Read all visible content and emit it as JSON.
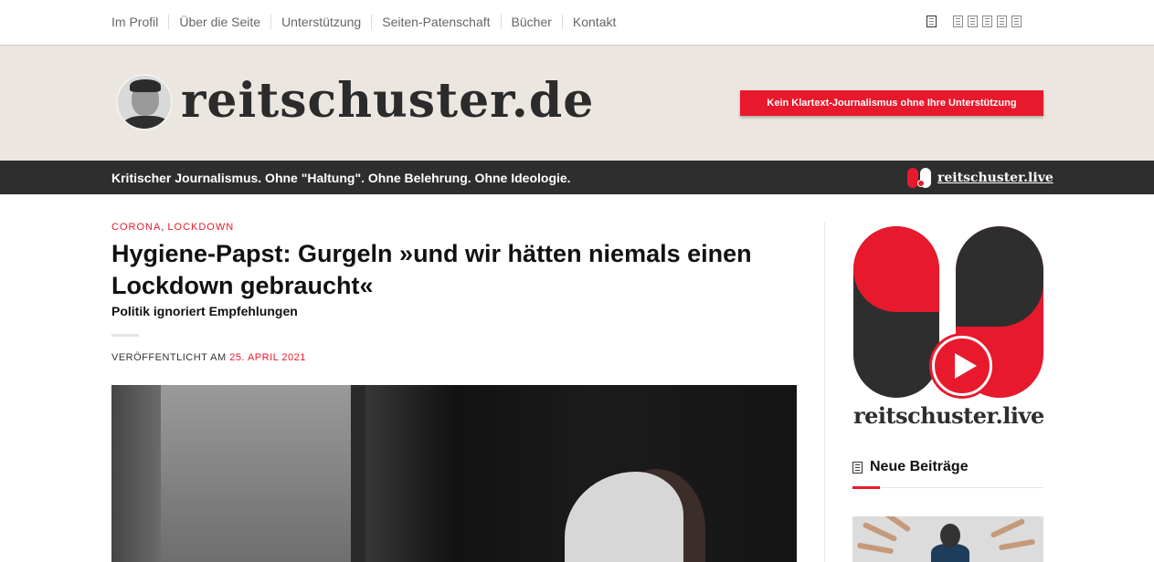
{
  "nav": {
    "links": [
      "Im Profil",
      "Über die Seite",
      "Unterstützung",
      "Seiten-Patenschaft",
      "Bücher",
      "Kontakt"
    ]
  },
  "header": {
    "logo_text": "reitschuster.de",
    "support_button": "Kein Klartext-Journalismus ohne Ihre Unterstützung"
  },
  "slogan_bar": {
    "slogan": "Kritischer Journalismus. Ohne \"Haltung\". Ohne Belehrung. Ohne Ideologie.",
    "live_label": "reitschuster.live"
  },
  "article": {
    "categories": [
      "CORONA",
      "LOCKDOWN"
    ],
    "category_separator": ",",
    "title": "Hygiene-Papst: Gurgeln »und wir hätten niemals einen Lockdown gebraucht«",
    "subtitle": "Politik ignoriert Empfehlungen",
    "published_label": "VERÖFFENTLICHT AM",
    "published_date": "25. APRIL 2021"
  },
  "sidebar": {
    "live_banner_text": "reitschuster.live",
    "recent_posts_heading": "Neue Beiträge"
  },
  "colors": {
    "accent": "#e8192c",
    "dark": "#2e2e2e",
    "header_bg": "#ebe6df"
  }
}
